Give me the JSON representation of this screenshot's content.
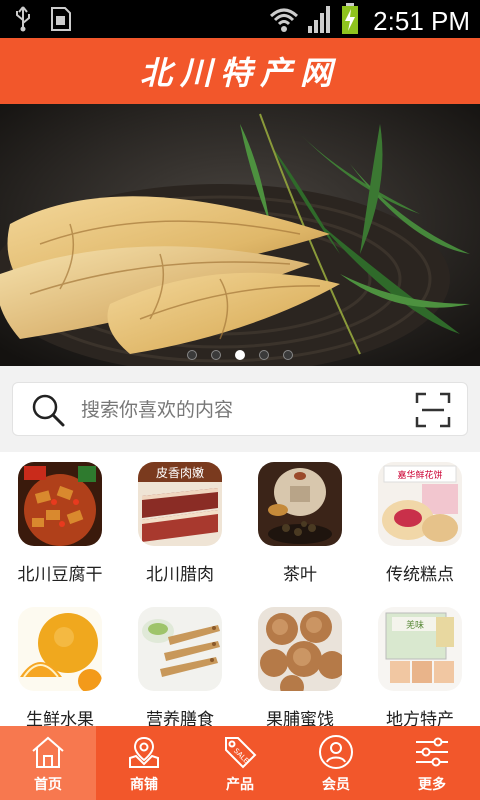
{
  "status_bar": {
    "time": "2:51 PM",
    "icons": [
      "usb-icon",
      "sim-card-icon",
      "wifi-icon",
      "signal-icon",
      "battery-charging-icon"
    ]
  },
  "header": {
    "title": "北川特产网"
  },
  "banner": {
    "image": "bamboo-shoots-photo",
    "dots_total": 5,
    "dots_active_index": 2
  },
  "search": {
    "placeholder": "搜索你喜欢的内容",
    "search_icon": "search-icon",
    "scan_icon": "scan-icon"
  },
  "categories": [
    {
      "label": "北川豆腐干"
    },
    {
      "label": "北川腊肉"
    },
    {
      "label": "茶叶"
    },
    {
      "label": "传统糕点"
    },
    {
      "label": "生鲜水果"
    },
    {
      "label": "营养膳食"
    },
    {
      "label": "果脯蜜饯"
    },
    {
      "label": "地方特产"
    }
  ],
  "tabs": [
    {
      "label": "首页",
      "icon": "home-icon",
      "active": true
    },
    {
      "label": "商铺",
      "icon": "store-map-icon",
      "active": false
    },
    {
      "label": "产品",
      "icon": "sale-tag-icon",
      "active": false
    },
    {
      "label": "会员",
      "icon": "member-icon",
      "active": false
    },
    {
      "label": "更多",
      "icon": "more-settings-icon",
      "active": false
    }
  ],
  "colors": {
    "brand": "#f2572b",
    "tab_active": "#f7784f",
    "status_bar": "#000000"
  }
}
